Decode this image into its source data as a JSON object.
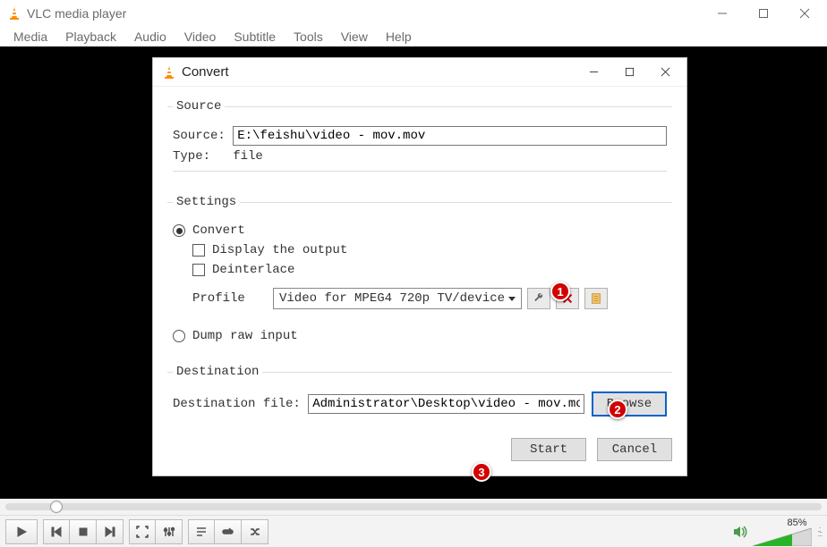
{
  "app_title": "VLC media player",
  "menu": [
    "Media",
    "Playback",
    "Audio",
    "Video",
    "Subtitle",
    "Tools",
    "View",
    "Help"
  ],
  "dialog": {
    "title": "Convert",
    "source_group": "Source",
    "source_label": "Source: ",
    "source_value": "E:\\feishu\\video - mov.mov",
    "type_label": "Type:   ",
    "type_value": "file",
    "settings_group": "Settings",
    "convert_radio": "Convert",
    "display_output_check": "Display the output",
    "deinterlace_check": "Deinterlace",
    "profile_label": "Profile",
    "profile_value": "Video for MPEG4 720p TV/device",
    "dump_radio": "Dump raw input",
    "destination_group": "Destination",
    "dest_label": "Destination file: ",
    "dest_value": "Administrator\\Desktop\\video - mov.mov",
    "browse_button": "Browse",
    "start_button": "Start",
    "cancel_button": "Cancel"
  },
  "annotations": {
    "b1": "1",
    "b2": "2",
    "b3": "3"
  },
  "volume_percent": "85%"
}
